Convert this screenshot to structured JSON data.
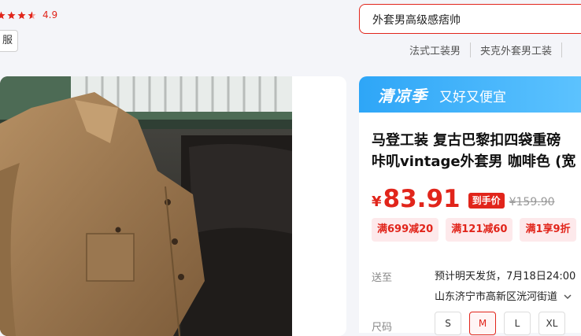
{
  "rating": {
    "value": "4.9",
    "stars": 4.5
  },
  "service_tag": "服",
  "search": {
    "value": "外套男高级感痞帅"
  },
  "hot_words": [
    "法式工装男",
    "夹克外套男工装",
    ""
  ],
  "promo": {
    "logo": "清凉季",
    "slogan": "又好又便宜"
  },
  "product": {
    "title_line1": "马登工装 复古巴黎扣四袋重磅",
    "title_line2": "咔叽vintage外套男 咖啡色 (宽",
    "price_currency": "¥",
    "price": "83.91",
    "price_tag": "到手价",
    "original_price": "¥159.90",
    "coupons": [
      "满699减20",
      "满121减60",
      "满1享9折"
    ]
  },
  "shipping": {
    "label": "送至",
    "estimate": "预计明天发货，7月18日24:00",
    "address": "山东济宁市高新区洸河街道"
  },
  "size": {
    "label": "尺码",
    "options": [
      "S",
      "M",
      "L",
      "XL"
    ],
    "selected": "M"
  },
  "colors": {
    "accent": "#e1251b",
    "promo_blue": "#2ea6f7"
  }
}
